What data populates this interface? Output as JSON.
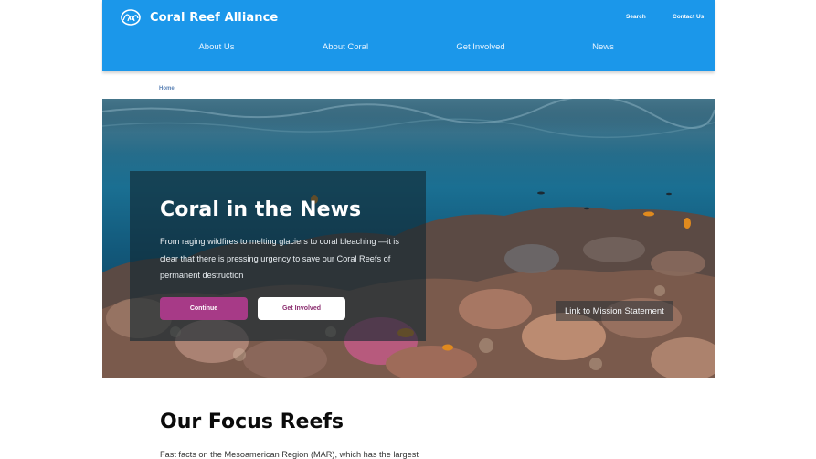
{
  "header": {
    "brand_name": "Coral Reef Alliance",
    "logo_icon": "coral-logo-icon",
    "utility_links": {
      "search": "Search",
      "contact": "Contact Us"
    },
    "nav": [
      "About Us",
      "About Coral",
      "Get Involved",
      "News"
    ],
    "background_color": "#1b97ea"
  },
  "breadcrumb": {
    "home": "Home"
  },
  "hero": {
    "title": "Coral in the News",
    "text": "From raging wildfires to melting glaciers to coral bleaching —it is clear that there is pressing urgency to save our Coral Reefs of permanent destruction",
    "continue_label": "Continue",
    "get_involved_label": "Get Involved",
    "mission_link": "Link to Mission Statement",
    "accent_color": "#a73a87"
  },
  "focus": {
    "title": "Our Focus Reefs",
    "text": "Fast facts on the Mesoamerican Region (MAR), which has the largest"
  }
}
